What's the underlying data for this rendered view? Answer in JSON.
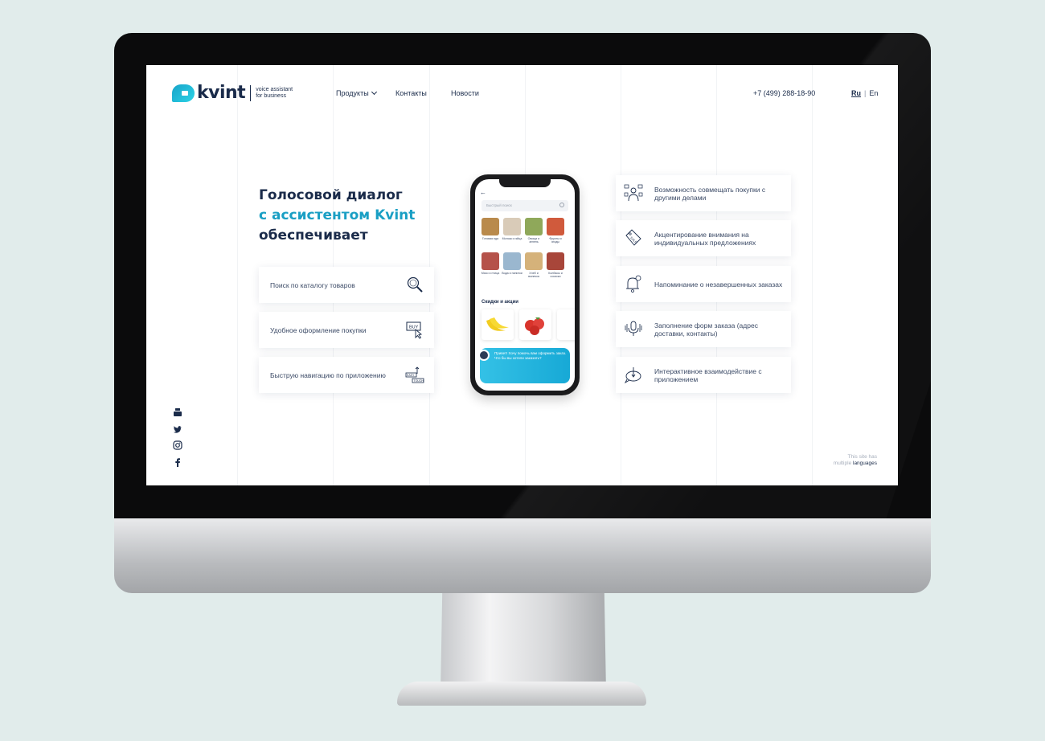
{
  "brand": {
    "logo_word": "kvint",
    "tagline_line1": "voice assistant",
    "tagline_line2": "for business"
  },
  "nav": {
    "products": "Продукты",
    "contacts": "Контакты",
    "news": "Новости"
  },
  "header": {
    "phone": "+7 (499) 288-18-90",
    "lang_active": "Ru",
    "lang_other": "En"
  },
  "hero": {
    "line1": "Голосовой диалог",
    "line2": "с ассистентом Kvint",
    "line3": "обеспечивает"
  },
  "left_features": [
    {
      "text": "Поиск по каталогу товаров",
      "icon": "search-icon"
    },
    {
      "text": "Удобное оформление покупки",
      "icon": "buy-click-icon"
    },
    {
      "text": "Быструю навигацию по приложению",
      "icon": "easy-touch-icon"
    }
  ],
  "right_features": [
    {
      "text": "Возможность совмещать покупки с другими делами",
      "icon": "multitask-person-icon"
    },
    {
      "text": "Акцентирование внимания на индивидуальных предложениях",
      "icon": "sale-tag-icon"
    },
    {
      "text": "Напоминание о незавершенных заказах",
      "icon": "bell-icon"
    },
    {
      "text": "Заполнение форм заказа (адрес доставки, контакты)",
      "icon": "voice-mic-icon"
    },
    {
      "text": "Интерактивное взаимодействие с приложением",
      "icon": "chat-touch-icon"
    }
  ],
  "social": [
    "youtube-icon",
    "twitter-icon",
    "instagram-icon",
    "facebook-icon"
  ],
  "footnote": {
    "line1": "This site has",
    "line2_prefix": "multiple",
    "line2_word": "languages"
  },
  "phone_app": {
    "search_placeholder": "Быстрый поиск",
    "categories": [
      {
        "label": "Готовая еда",
        "color": "#b98a4c"
      },
      {
        "label": "Молоко и яйца",
        "color": "#d9cbb8"
      },
      {
        "label": "Овощи и зелень",
        "color": "#8fa85a"
      },
      {
        "label": "Фрукты и ягоды",
        "color": "#d05a3c"
      },
      {
        "label": "Мясо и птица",
        "color": "#b5524a"
      },
      {
        "label": "Вода и напитки",
        "color": "#9ab7cf"
      },
      {
        "label": "Хлеб и выпечка",
        "color": "#d5b27a"
      },
      {
        "label": "Колбасы и сосиски",
        "color": "#a8463a"
      }
    ],
    "section_title": "Скидки и акции",
    "chat_message": "Привет! Хочу помочь вам оформить заказ. Что бы вы хотели заказать?"
  }
}
